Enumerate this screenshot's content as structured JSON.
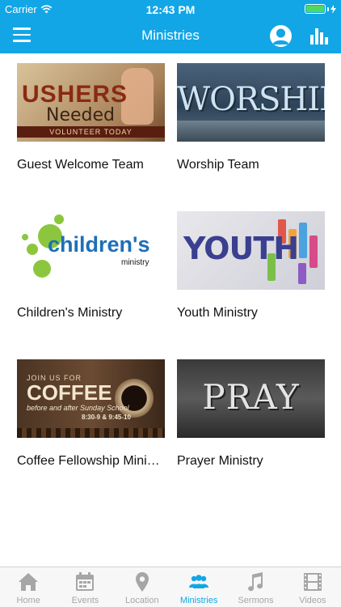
{
  "status": {
    "carrier": "Carrier",
    "time": "12:43 PM"
  },
  "nav": {
    "title": "Ministries"
  },
  "ministries": [
    {
      "label": "Guest Welcome Team",
      "image": {
        "line1": "USHERS",
        "line2": "Needed",
        "line3": "VOLUNTEER TODAY"
      }
    },
    {
      "label": "Worship Team",
      "image": {
        "line1": "WORSHIP"
      }
    },
    {
      "label": "Children's Ministry",
      "image": {
        "line1": "children's",
        "line2": "ministry"
      }
    },
    {
      "label": "Youth Ministry",
      "image": {
        "line1": "YOUTH"
      }
    },
    {
      "label": "Coffee Fellowship Ministry",
      "image": {
        "line0": "JOIN US FOR",
        "line1": "COFFEE",
        "line2": "before and after Sunday School",
        "line3": "8:30-9 & 9:45-10"
      }
    },
    {
      "label": "Prayer Ministry",
      "image": {
        "line1": "PRAY"
      }
    }
  ],
  "tabs": [
    {
      "label": "Home",
      "icon": "home-icon",
      "active": false
    },
    {
      "label": "Events",
      "icon": "calendar-icon",
      "active": false
    },
    {
      "label": "Location",
      "icon": "map-pin-icon",
      "active": false
    },
    {
      "label": "Ministries",
      "icon": "people-icon",
      "active": true
    },
    {
      "label": "Sermons",
      "icon": "music-note-icon",
      "active": false
    },
    {
      "label": "Videos",
      "icon": "film-icon",
      "active": false
    }
  ],
  "colors": {
    "accent": "#12a6e6",
    "inactive": "#a6a6a6"
  }
}
